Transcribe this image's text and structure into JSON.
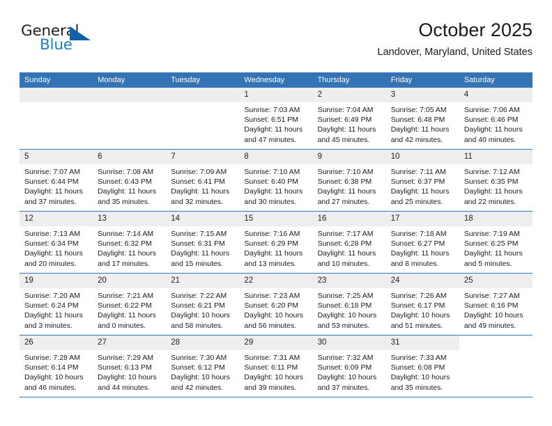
{
  "brand": {
    "word1": "General",
    "word2": "Blue",
    "accent_color": "#1362a8",
    "text_color": "#231f20"
  },
  "header": {
    "month_title": "October 2025",
    "location": "Landover, Maryland, United States",
    "header_bg": "#3474b4"
  },
  "weekday_headers": [
    "Sunday",
    "Monday",
    "Tuesday",
    "Wednesday",
    "Thursday",
    "Friday",
    "Saturday"
  ],
  "weeks": [
    [
      {
        "day": "",
        "empty": true
      },
      {
        "day": "",
        "empty": true
      },
      {
        "day": "",
        "empty": true
      },
      {
        "day": "1",
        "sunrise": "Sunrise: 7:03 AM",
        "sunset": "Sunset: 6:51 PM",
        "daylight1": "Daylight: 11 hours",
        "daylight2": "and 47 minutes."
      },
      {
        "day": "2",
        "sunrise": "Sunrise: 7:04 AM",
        "sunset": "Sunset: 6:49 PM",
        "daylight1": "Daylight: 11 hours",
        "daylight2": "and 45 minutes."
      },
      {
        "day": "3",
        "sunrise": "Sunrise: 7:05 AM",
        "sunset": "Sunset: 6:48 PM",
        "daylight1": "Daylight: 11 hours",
        "daylight2": "and 42 minutes."
      },
      {
        "day": "4",
        "sunrise": "Sunrise: 7:06 AM",
        "sunset": "Sunset: 6:46 PM",
        "daylight1": "Daylight: 11 hours",
        "daylight2": "and 40 minutes."
      }
    ],
    [
      {
        "day": "5",
        "sunrise": "Sunrise: 7:07 AM",
        "sunset": "Sunset: 6:44 PM",
        "daylight1": "Daylight: 11 hours",
        "daylight2": "and 37 minutes."
      },
      {
        "day": "6",
        "sunrise": "Sunrise: 7:08 AM",
        "sunset": "Sunset: 6:43 PM",
        "daylight1": "Daylight: 11 hours",
        "daylight2": "and 35 minutes."
      },
      {
        "day": "7",
        "sunrise": "Sunrise: 7:09 AM",
        "sunset": "Sunset: 6:41 PM",
        "daylight1": "Daylight: 11 hours",
        "daylight2": "and 32 minutes."
      },
      {
        "day": "8",
        "sunrise": "Sunrise: 7:10 AM",
        "sunset": "Sunset: 6:40 PM",
        "daylight1": "Daylight: 11 hours",
        "daylight2": "and 30 minutes."
      },
      {
        "day": "9",
        "sunrise": "Sunrise: 7:10 AM",
        "sunset": "Sunset: 6:38 PM",
        "daylight1": "Daylight: 11 hours",
        "daylight2": "and 27 minutes."
      },
      {
        "day": "10",
        "sunrise": "Sunrise: 7:11 AM",
        "sunset": "Sunset: 6:37 PM",
        "daylight1": "Daylight: 11 hours",
        "daylight2": "and 25 minutes."
      },
      {
        "day": "11",
        "sunrise": "Sunrise: 7:12 AM",
        "sunset": "Sunset: 6:35 PM",
        "daylight1": "Daylight: 11 hours",
        "daylight2": "and 22 minutes."
      }
    ],
    [
      {
        "day": "12",
        "sunrise": "Sunrise: 7:13 AM",
        "sunset": "Sunset: 6:34 PM",
        "daylight1": "Daylight: 11 hours",
        "daylight2": "and 20 minutes."
      },
      {
        "day": "13",
        "sunrise": "Sunrise: 7:14 AM",
        "sunset": "Sunset: 6:32 PM",
        "daylight1": "Daylight: 11 hours",
        "daylight2": "and 17 minutes."
      },
      {
        "day": "14",
        "sunrise": "Sunrise: 7:15 AM",
        "sunset": "Sunset: 6:31 PM",
        "daylight1": "Daylight: 11 hours",
        "daylight2": "and 15 minutes."
      },
      {
        "day": "15",
        "sunrise": "Sunrise: 7:16 AM",
        "sunset": "Sunset: 6:29 PM",
        "daylight1": "Daylight: 11 hours",
        "daylight2": "and 13 minutes."
      },
      {
        "day": "16",
        "sunrise": "Sunrise: 7:17 AM",
        "sunset": "Sunset: 6:28 PM",
        "daylight1": "Daylight: 11 hours",
        "daylight2": "and 10 minutes."
      },
      {
        "day": "17",
        "sunrise": "Sunrise: 7:18 AM",
        "sunset": "Sunset: 6:27 PM",
        "daylight1": "Daylight: 11 hours",
        "daylight2": "and 8 minutes."
      },
      {
        "day": "18",
        "sunrise": "Sunrise: 7:19 AM",
        "sunset": "Sunset: 6:25 PM",
        "daylight1": "Daylight: 11 hours",
        "daylight2": "and 5 minutes."
      }
    ],
    [
      {
        "day": "19",
        "sunrise": "Sunrise: 7:20 AM",
        "sunset": "Sunset: 6:24 PM",
        "daylight1": "Daylight: 11 hours",
        "daylight2": "and 3 minutes."
      },
      {
        "day": "20",
        "sunrise": "Sunrise: 7:21 AM",
        "sunset": "Sunset: 6:22 PM",
        "daylight1": "Daylight: 11 hours",
        "daylight2": "and 0 minutes."
      },
      {
        "day": "21",
        "sunrise": "Sunrise: 7:22 AM",
        "sunset": "Sunset: 6:21 PM",
        "daylight1": "Daylight: 10 hours",
        "daylight2": "and 58 minutes."
      },
      {
        "day": "22",
        "sunrise": "Sunrise: 7:23 AM",
        "sunset": "Sunset: 6:20 PM",
        "daylight1": "Daylight: 10 hours",
        "daylight2": "and 56 minutes."
      },
      {
        "day": "23",
        "sunrise": "Sunrise: 7:25 AM",
        "sunset": "Sunset: 6:18 PM",
        "daylight1": "Daylight: 10 hours",
        "daylight2": "and 53 minutes."
      },
      {
        "day": "24",
        "sunrise": "Sunrise: 7:26 AM",
        "sunset": "Sunset: 6:17 PM",
        "daylight1": "Daylight: 10 hours",
        "daylight2": "and 51 minutes."
      },
      {
        "day": "25",
        "sunrise": "Sunrise: 7:27 AM",
        "sunset": "Sunset: 6:16 PM",
        "daylight1": "Daylight: 10 hours",
        "daylight2": "and 49 minutes."
      }
    ],
    [
      {
        "day": "26",
        "sunrise": "Sunrise: 7:28 AM",
        "sunset": "Sunset: 6:14 PM",
        "daylight1": "Daylight: 10 hours",
        "daylight2": "and 46 minutes."
      },
      {
        "day": "27",
        "sunrise": "Sunrise: 7:29 AM",
        "sunset": "Sunset: 6:13 PM",
        "daylight1": "Daylight: 10 hours",
        "daylight2": "and 44 minutes."
      },
      {
        "day": "28",
        "sunrise": "Sunrise: 7:30 AM",
        "sunset": "Sunset: 6:12 PM",
        "daylight1": "Daylight: 10 hours",
        "daylight2": "and 42 minutes."
      },
      {
        "day": "29",
        "sunrise": "Sunrise: 7:31 AM",
        "sunset": "Sunset: 6:11 PM",
        "daylight1": "Daylight: 10 hours",
        "daylight2": "and 39 minutes."
      },
      {
        "day": "30",
        "sunrise": "Sunrise: 7:32 AM",
        "sunset": "Sunset: 6:09 PM",
        "daylight1": "Daylight: 10 hours",
        "daylight2": "and 37 minutes."
      },
      {
        "day": "31",
        "sunrise": "Sunrise: 7:33 AM",
        "sunset": "Sunset: 6:08 PM",
        "daylight1": "Daylight: 10 hours",
        "daylight2": "and 35 minutes."
      },
      {
        "day": "",
        "empty": true,
        "blank": true
      }
    ]
  ]
}
